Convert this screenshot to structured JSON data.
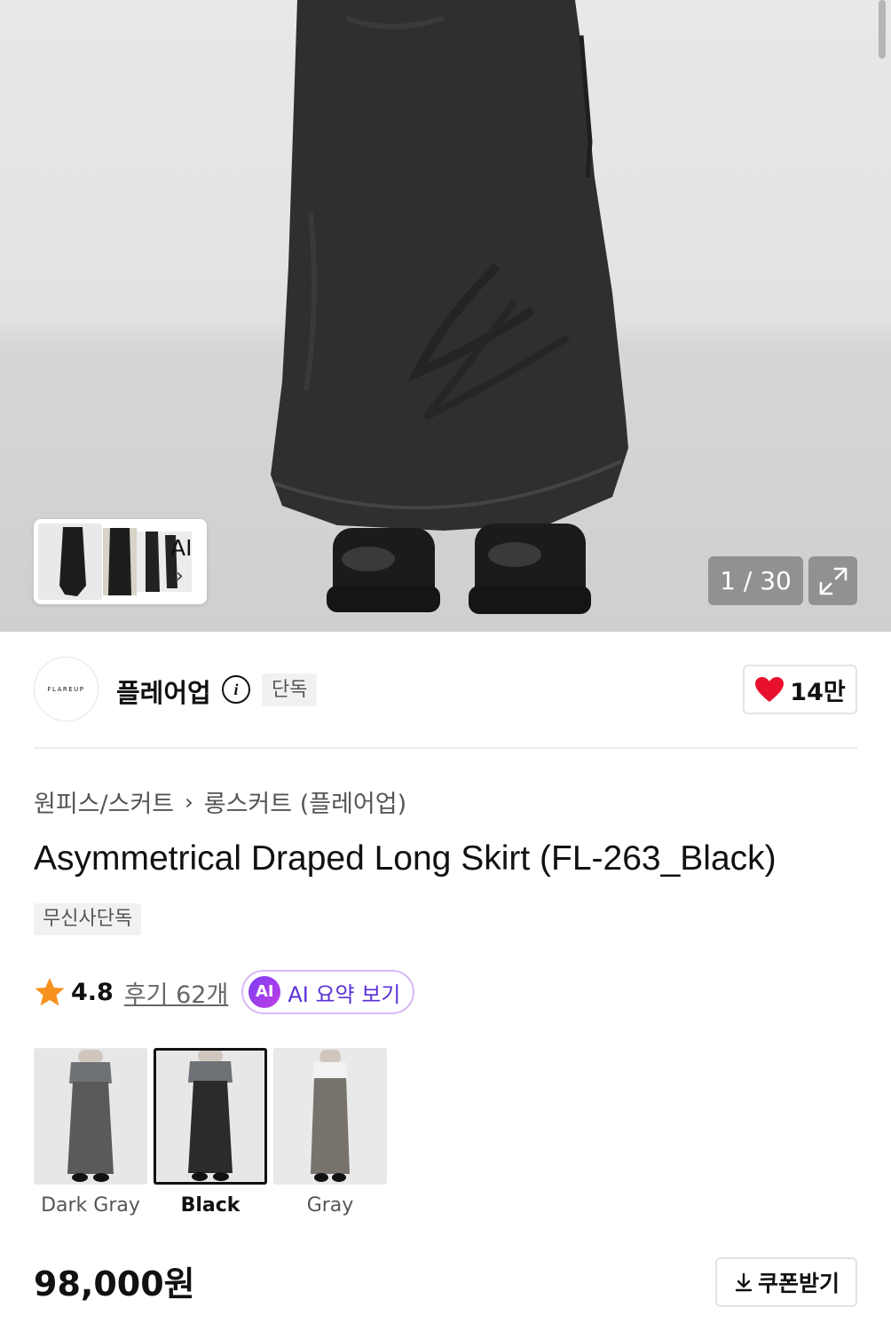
{
  "gallery": {
    "current_page": "1",
    "total_pages": "30",
    "counter_text": "1 / 30",
    "ai_label": "AI",
    "ai_chevron": "›",
    "expand_icon": "expand-icon"
  },
  "brand": {
    "logo_text": "FLAREUP",
    "name": "플레어업",
    "info_icon": "i",
    "exclusive_tag": "단독",
    "likes": "14만",
    "like_icon": "heart-icon"
  },
  "product": {
    "breadcrumb": [
      "원피스/스커트",
      "롱스커트 (플레어업)"
    ],
    "breadcrumb_sep": "›",
    "title": "Asymmetrical Draped Long Skirt (FL-263_Black)",
    "badge": "무신사단독",
    "rating": "4.8",
    "reviews": "후기 62개",
    "ai_badge": "AI",
    "ai_summary": "AI 요약 보기",
    "colors": [
      {
        "label": "Dark Gray",
        "swatch": "#5a5a5a",
        "selected": false
      },
      {
        "label": "Black",
        "swatch": "#2b2b2b",
        "selected": true
      },
      {
        "label": "Gray",
        "swatch": "#77726c",
        "selected": false
      }
    ],
    "price": "98,000원",
    "coupon_label": "쿠폰받기"
  },
  "colors": {
    "heart": "#e8112d",
    "star": "#f7921e",
    "ai_accent": "#5a2fd6"
  }
}
